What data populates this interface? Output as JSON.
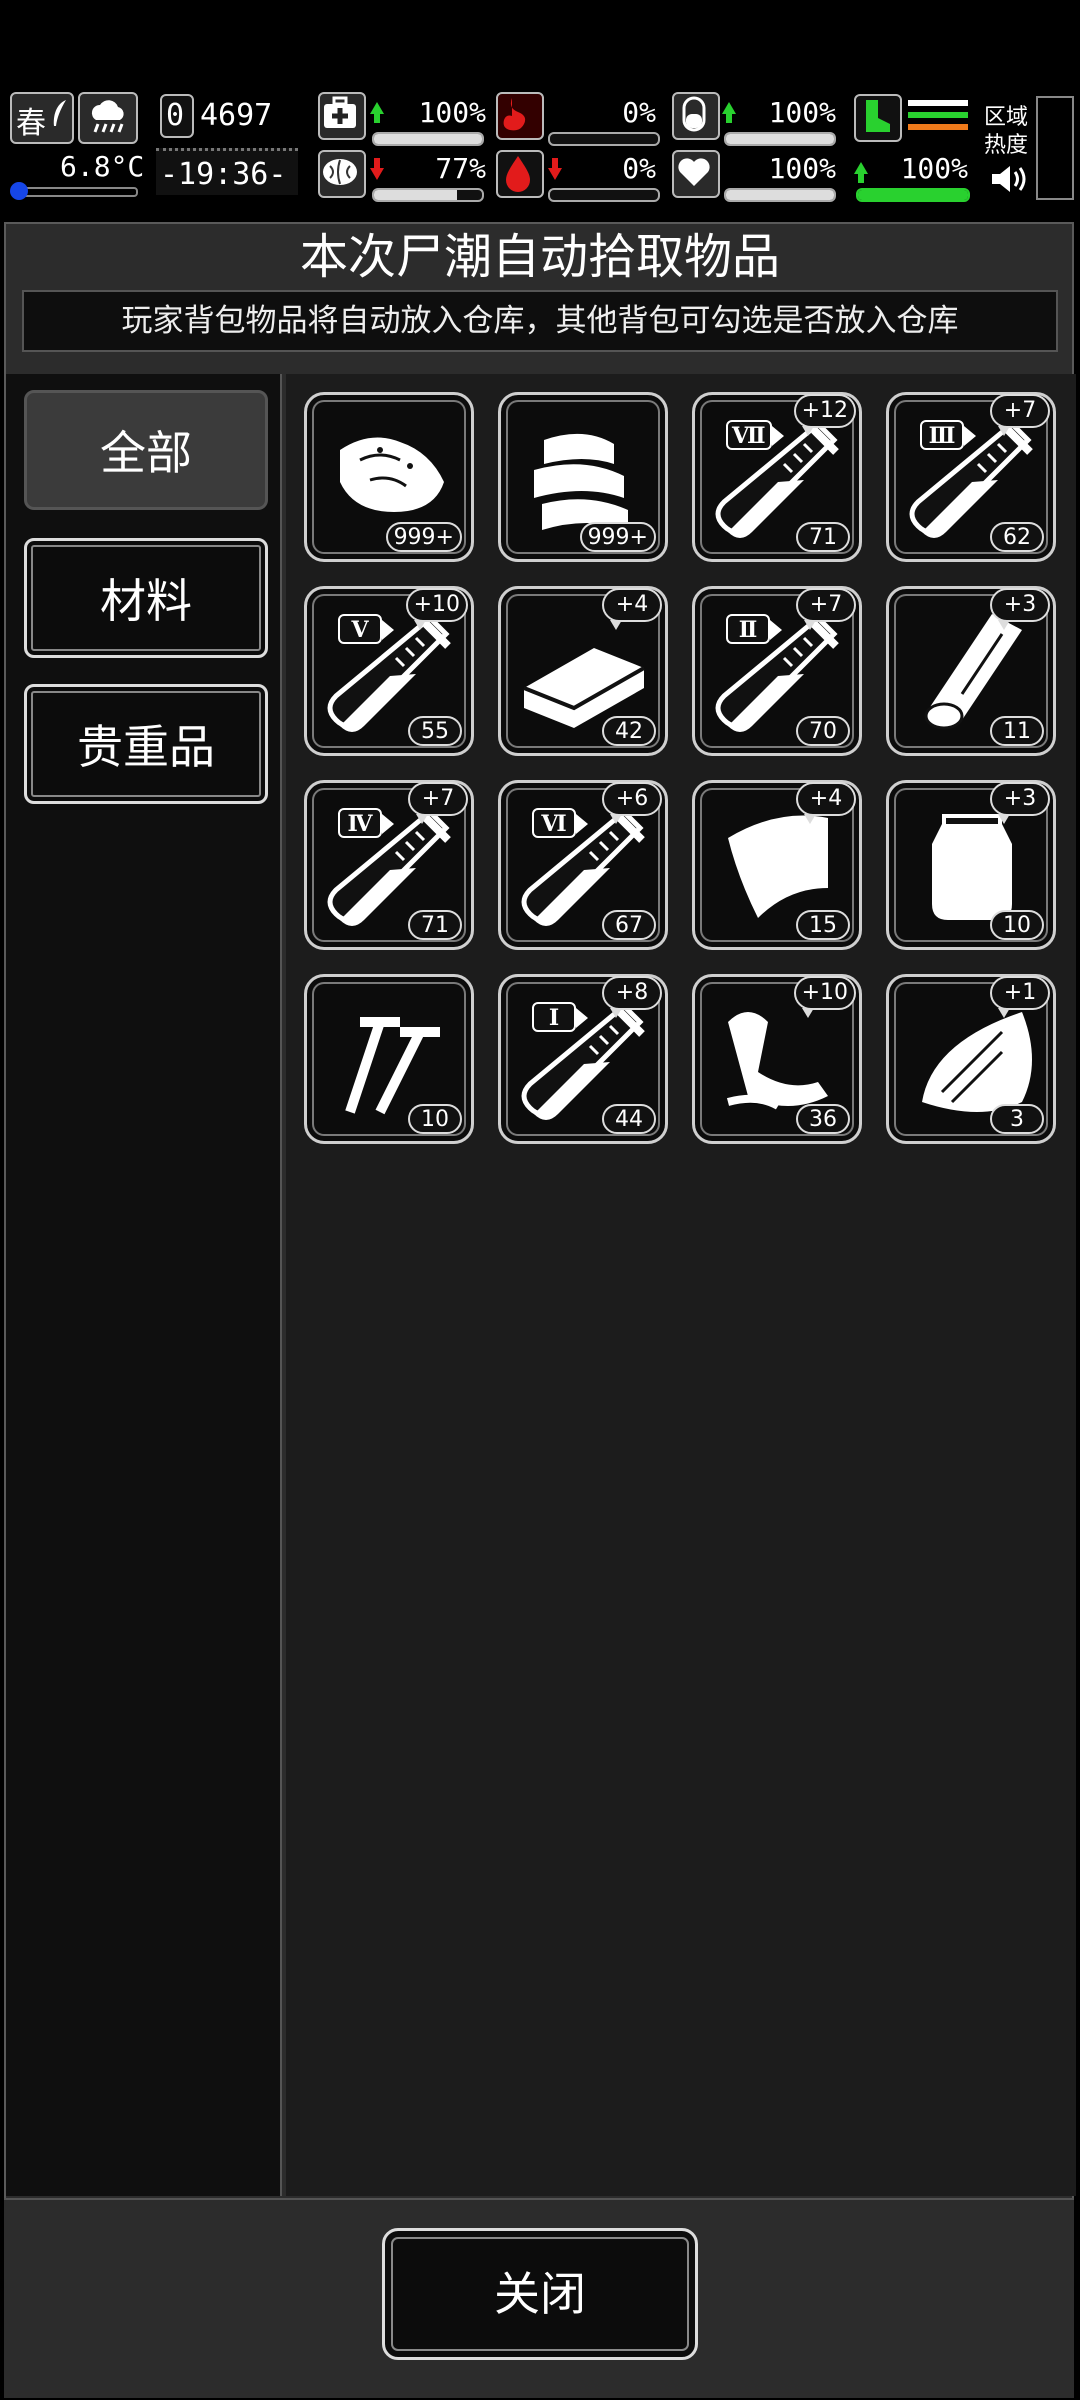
{
  "status": {
    "season": "春",
    "temperature": "6.8°C",
    "day_counter_digit": "0",
    "day_counter": "4697",
    "clock": "-19:36-",
    "stats": [
      {
        "name": "health",
        "icon": "medkit-icon",
        "trend": "up",
        "value": "100%",
        "level": 1.0,
        "accent": "#29d12f"
      },
      {
        "name": "sanity",
        "icon": "brain-icon",
        "trend": "down",
        "value": "77%",
        "level": 0.77,
        "accent": "#e21b1b"
      },
      {
        "name": "hunger",
        "icon": "stomach-icon",
        "trend": "none",
        "value": "0%",
        "level": 0.0,
        "accent": "#e21b1b"
      },
      {
        "name": "bleeding",
        "icon": "blood-drop-icon",
        "trend": "down",
        "value": "0%",
        "level": 0.0,
        "accent": "#e21b1b"
      },
      {
        "name": "medicine",
        "icon": "pill-icon",
        "trend": "up",
        "value": "100%",
        "level": 1.0,
        "accent": "#29d12f"
      },
      {
        "name": "heart",
        "icon": "heart-icon",
        "trend": "none",
        "value": "100%",
        "level": 1.0,
        "accent": "#ffffff"
      },
      {
        "name": "stamina",
        "icon": "boot-icon",
        "trend": "up",
        "value": "100%",
        "level": 1.0,
        "accent": "#29d12f"
      }
    ],
    "zone_label": "区域\n热度",
    "zone_label_line1": "区域",
    "zone_label_line2": "热度"
  },
  "dialog": {
    "title": "本次尸潮自动拾取物品",
    "notice": "玩家背包物品将自动放入仓库，其他背包可勾选是否放入仓库",
    "categories": [
      "全部",
      "材料",
      "贵重品"
    ],
    "active_category": "全部",
    "close_label": "关闭"
  },
  "items": [
    {
      "icon": "raw-meat-icon",
      "count": "999+",
      "bonus": "",
      "tier": ""
    },
    {
      "icon": "cloth-icon",
      "count": "999+",
      "bonus": "",
      "tier": ""
    },
    {
      "icon": "test-tube-icon",
      "count": "71",
      "bonus": "+12",
      "tier": "Ⅶ"
    },
    {
      "icon": "test-tube-icon",
      "count": "62",
      "bonus": "+7",
      "tier": "Ⅲ"
    },
    {
      "icon": "test-tube-icon",
      "count": "55",
      "bonus": "+10",
      "tier": "Ⅴ"
    },
    {
      "icon": "wood-plank-icon",
      "count": "42",
      "bonus": "+4",
      "tier": ""
    },
    {
      "icon": "test-tube-icon",
      "count": "70",
      "bonus": "+7",
      "tier": "Ⅱ"
    },
    {
      "icon": "log-icon",
      "count": "11",
      "bonus": "+3",
      "tier": ""
    },
    {
      "icon": "test-tube-icon",
      "count": "71",
      "bonus": "+7",
      "tier": "Ⅳ"
    },
    {
      "icon": "test-tube-icon",
      "count": "67",
      "bonus": "+6",
      "tier": "Ⅵ"
    },
    {
      "icon": "leather-icon",
      "count": "15",
      "bonus": "+4",
      "tier": ""
    },
    {
      "icon": "plastic-bag-icon",
      "count": "10",
      "bonus": "+3",
      "tier": ""
    },
    {
      "icon": "nails-icon",
      "count": "10",
      "bonus": "",
      "tier": ""
    },
    {
      "icon": "test-tube-icon",
      "count": "44",
      "bonus": "+8",
      "tier": "Ⅰ"
    },
    {
      "icon": "scrap-parts-icon",
      "count": "36",
      "bonus": "+10",
      "tier": ""
    },
    {
      "icon": "wood-chip-icon",
      "count": "3",
      "bonus": "+1",
      "tier": ""
    }
  ]
}
